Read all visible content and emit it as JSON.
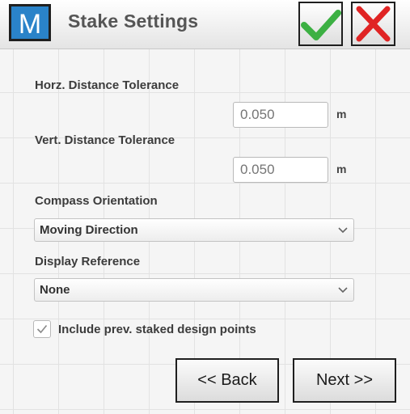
{
  "header": {
    "logo_letter": "M",
    "title": "Stake Settings",
    "confirm_icon": "checkmark-icon",
    "cancel_icon": "close-icon",
    "confirm_color": "#3cb043",
    "cancel_color": "#e02424"
  },
  "form": {
    "horz_tolerance": {
      "label": "Horz. Distance Tolerance",
      "placeholder": "0.050",
      "value": "",
      "unit": "m"
    },
    "vert_tolerance": {
      "label": "Vert. Distance Tolerance",
      "placeholder": "0.050",
      "value": "",
      "unit": "m"
    },
    "compass_orientation": {
      "label": "Compass Orientation",
      "selected": "Moving Direction"
    },
    "display_reference": {
      "label": "Display Reference",
      "selected": "None"
    },
    "include_prev_staked": {
      "label": "Include prev. staked design points",
      "checked": true
    }
  },
  "footer": {
    "back_label": "<< Back",
    "next_label": "Next >>"
  }
}
